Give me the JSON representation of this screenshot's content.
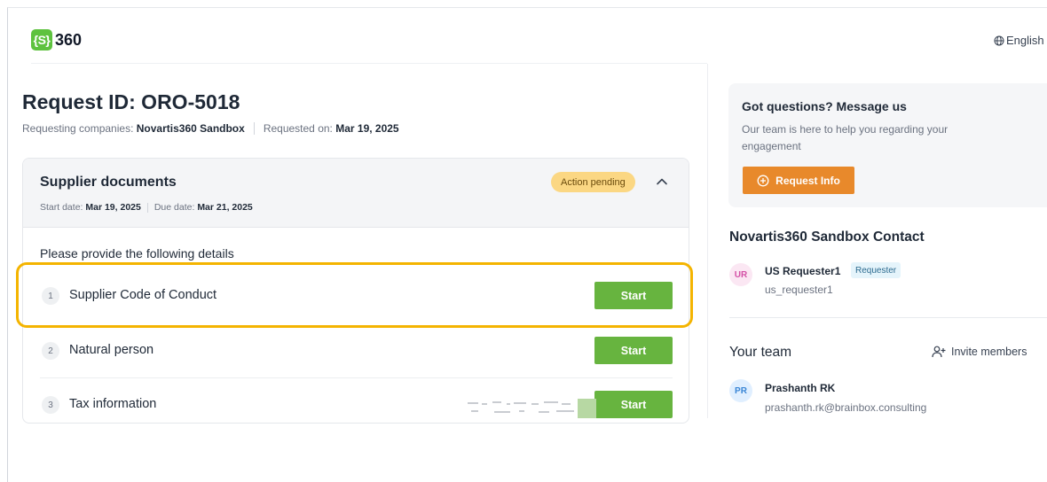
{
  "header": {
    "logo_bracket": "{S}",
    "logo_text": "360",
    "language": "English"
  },
  "request": {
    "title": "Request ID: ORO-5018",
    "companies_label": "Requesting companies:",
    "companies_value": "Novartis360 Sandbox",
    "requested_label": "Requested on:",
    "requested_value": "Mar 19, 2025"
  },
  "section": {
    "title": "Supplier documents",
    "start_label": "Start date:",
    "start_value": "Mar 19, 2025",
    "due_label": "Due date:",
    "due_value": "Mar 21, 2025",
    "status_badge": "Action pending",
    "instructions": "Please provide the following details",
    "items": [
      {
        "number": "1",
        "label": "Supplier Code of Conduct",
        "button": "Start"
      },
      {
        "number": "2",
        "label": "Natural person",
        "button": "Start"
      },
      {
        "number": "3",
        "label": "Tax information",
        "button": "Start"
      }
    ]
  },
  "help": {
    "title": "Got questions? Message us",
    "text": "Our team is here to help you regarding your engagement",
    "button": "Request Info"
  },
  "contact": {
    "title": "Novartis360 Sandbox Contact",
    "initials": "UR",
    "name": "US Requester1",
    "role": "Requester",
    "username": "us_requester1"
  },
  "team": {
    "title": "Your team",
    "invite_label": "Invite members",
    "members": [
      {
        "initials": "PR",
        "name": "Prashanth RK",
        "email": "prashanth.rk@brainbox.consulting"
      }
    ]
  },
  "colors": {
    "brand_green": "#5ec23f",
    "start_button": "#67b43f",
    "request_info_button": "#e8892b",
    "pending_badge": "#fbd783",
    "highlight_outline": "#f4b400"
  }
}
